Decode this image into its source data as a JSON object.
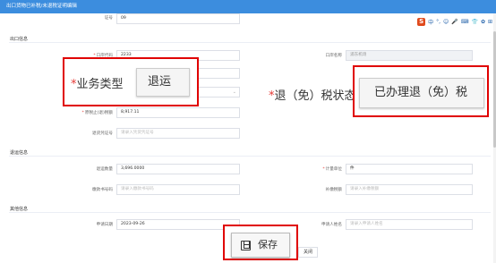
{
  "window": {
    "title": "出口货物已补税/未退税证明编辑"
  },
  "ime": {
    "logo": "S",
    "items": [
      "中",
      "°,",
      "☺",
      "🎤",
      "⌨",
      "👕",
      "✿",
      "⊞"
    ]
  },
  "top": {
    "serial_label": "证号",
    "serial_value": "09"
  },
  "sections": {
    "export": "出口信息",
    "return": "退运信息",
    "other": "其他信息"
  },
  "export": {
    "port_code_label": "口岸代码",
    "port_code_value": "2233",
    "port_name_label": "口岸名称",
    "port_name_value": "浦东机场",
    "tax_amount_label": "原税止(退)税额",
    "tax_amount_value": "8,917.11",
    "voucher_label": "退货凭证号",
    "voucher_placeholder": "请录入凭货凭证号"
  },
  "return_info": {
    "qty_label": "退运数量",
    "qty_value": "3,696.0000",
    "unit_label": "计量单位",
    "unit_value": "件",
    "customs_no_label": "缴款书号码",
    "customs_no_placeholder": "请录入缴款书号码",
    "tax_no_label": "补缴税额",
    "tax_no_placeholder": "请录入补缴税额"
  },
  "other": {
    "date_label": "申请日期",
    "date_value": "2023-09-26",
    "applicant_label": "申请人姓名",
    "applicant_placeholder": "请录入申请人姓名"
  },
  "zoom": {
    "business_type_label": "业务类型",
    "business_type_value": "退运",
    "tax_status_label": "退（免）税状态",
    "tax_status_value": "已办理退（免）税",
    "save_label": "保存"
  },
  "buttons": {
    "close": "关闭"
  }
}
